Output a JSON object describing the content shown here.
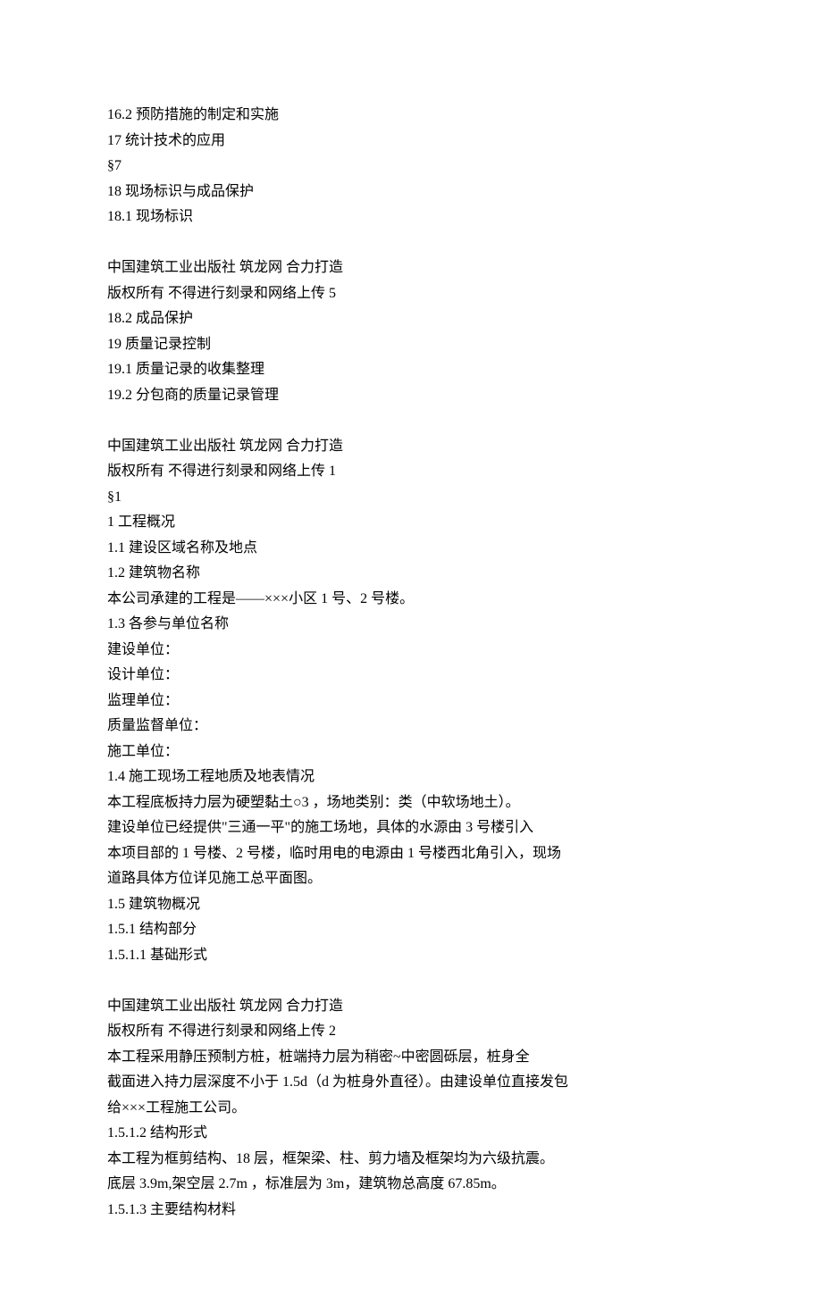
{
  "lines": [
    "16.2 预防措施的制定和实施",
    "17 统计技术的应用",
    "§7",
    "18 现场标识与成品保护",
    "18.1 现场标识",
    "",
    "中国建筑工业出版社 筑龙网 合力打造",
    "版权所有 不得进行刻录和网络上传 5",
    "18.2 成品保护",
    "19 质量记录控制",
    "19.1 质量记录的收集整理",
    "19.2 分包商的质量记录管理",
    "",
    "中国建筑工业出版社 筑龙网 合力打造",
    "版权所有 不得进行刻录和网络上传 1",
    "§1",
    "1 工程概况",
    "1.1 建设区域名称及地点",
    "1.2 建筑物名称",
    "本公司承建的工程是——×××小区 1 号、2 号楼。",
    "1.3 各参与单位名称",
    "建设单位：",
    "设计单位：",
    "监理单位：",
    "质量监督单位：",
    "施工单位：",
    "1.4 施工现场工程地质及地表情况",
    "本工程底板持力层为硬塑黏土○3 ，场地类别：类（中软场地土）。",
    "建设单位已经提供\"三通一平\"的施工场地，具体的水源由 3 号楼引入",
    "本项目部的 1 号楼、2 号楼，临时用电的电源由 1 号楼西北角引入，现场",
    "道路具体方位详见施工总平面图。",
    "1.5 建筑物概况",
    "1.5.1 结构部分",
    "1.5.1.1 基础形式",
    "",
    "中国建筑工业出版社 筑龙网 合力打造",
    "版权所有 不得进行刻录和网络上传 2",
    "本工程采用静压预制方桩，桩端持力层为稍密~中密圆砾层，桩身全",
    "截面进入持力层深度不小于 1.5d（d 为桩身外直径）。由建设单位直接发包",
    "给×××工程施工公司。",
    "1.5.1.2 结构形式",
    "本工程为框剪结构、18 层，框架梁、柱、剪力墙及框架均为六级抗震。",
    "底层 3.9m,架空层 2.7m ，标准层为 3m，建筑物总高度 67.85m。",
    "1.5.1.3 主要结构材料"
  ]
}
